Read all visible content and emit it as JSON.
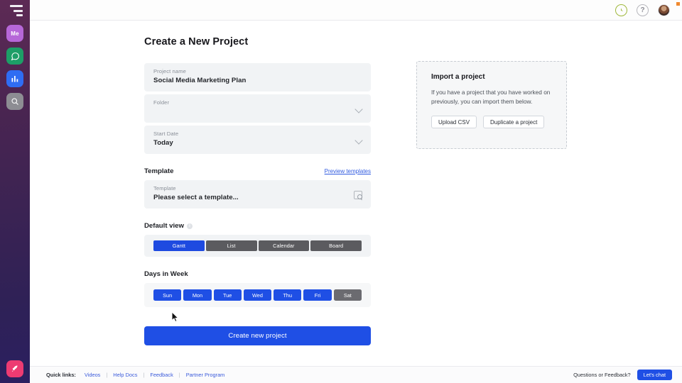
{
  "sidebar": {
    "logo_icon": "hamburger-logo-icon",
    "items": [
      {
        "label": "Me",
        "icon": "me-avatar-icon",
        "color": "#b667d8"
      },
      {
        "label": "",
        "icon": "chat-bubble-icon",
        "color": "#1d9e67"
      },
      {
        "label": "",
        "icon": "bar-chart-icon",
        "color": "#2f6df3"
      },
      {
        "label": "",
        "icon": "search-icon",
        "color": "#8d8d93"
      }
    ],
    "bottom_item": {
      "icon": "rocket-icon",
      "color": "#ed3b72"
    }
  },
  "header": {
    "icons": [
      {
        "name": "clock-icon",
        "color": "#9fb83c"
      },
      {
        "name": "help-icon",
        "glyph": "?",
        "color": "#b7b7bd"
      },
      {
        "name": "user-avatar",
        "color": "#7a4b33"
      }
    ],
    "notification_dot_color": "#f0892f"
  },
  "main": {
    "page_title": "Create a New Project",
    "fields": [
      {
        "label": "Project name",
        "value": "Social Media Marketing Plan",
        "chevron": false
      },
      {
        "label": "Folder",
        "value": "",
        "chevron": true
      },
      {
        "label": "Start Date",
        "value": "Today",
        "chevron": true
      }
    ],
    "template_section": {
      "title": "Template",
      "preview_link": "Preview templates",
      "field_label": "Template",
      "field_value": "Please select a template...",
      "search_icon": "template-search-icon"
    },
    "default_view": {
      "title": "Default view",
      "info_icon": "info-icon",
      "options": [
        {
          "label": "Gantt",
          "selected": true
        },
        {
          "label": "List",
          "selected": false
        },
        {
          "label": "Calendar",
          "selected": false
        },
        {
          "label": "Board",
          "selected": false
        }
      ]
    },
    "days_in_week": {
      "title": "Days in Week",
      "days": [
        {
          "label": "Sun",
          "selected": true
        },
        {
          "label": "Mon",
          "selected": true
        },
        {
          "label": "Tue",
          "selected": true
        },
        {
          "label": "Wed",
          "selected": true
        },
        {
          "label": "Thu",
          "selected": true
        },
        {
          "label": "Fri",
          "selected": true
        },
        {
          "label": "Sat",
          "selected": false
        }
      ]
    },
    "create_button": "Create new project"
  },
  "import_card": {
    "title": "Import a project",
    "body": "If you have a project that you have worked on previously, you can import them below.",
    "upload_button": "Upload CSV",
    "duplicate_button": "Duplicate a project"
  },
  "footer": {
    "quick_links_label": "Quick links:",
    "links": [
      "Videos",
      "Help Docs",
      "Feedback",
      "Partner Program"
    ],
    "separator": "|",
    "questions_label": "Questions or Feedback?",
    "chat_button": "Let's chat"
  },
  "colors": {
    "accent_blue": "#1f4fe5",
    "link_blue": "#3b5bdb",
    "field_bg": "#f1f3f5",
    "segment_off": "#5b5b5f"
  }
}
